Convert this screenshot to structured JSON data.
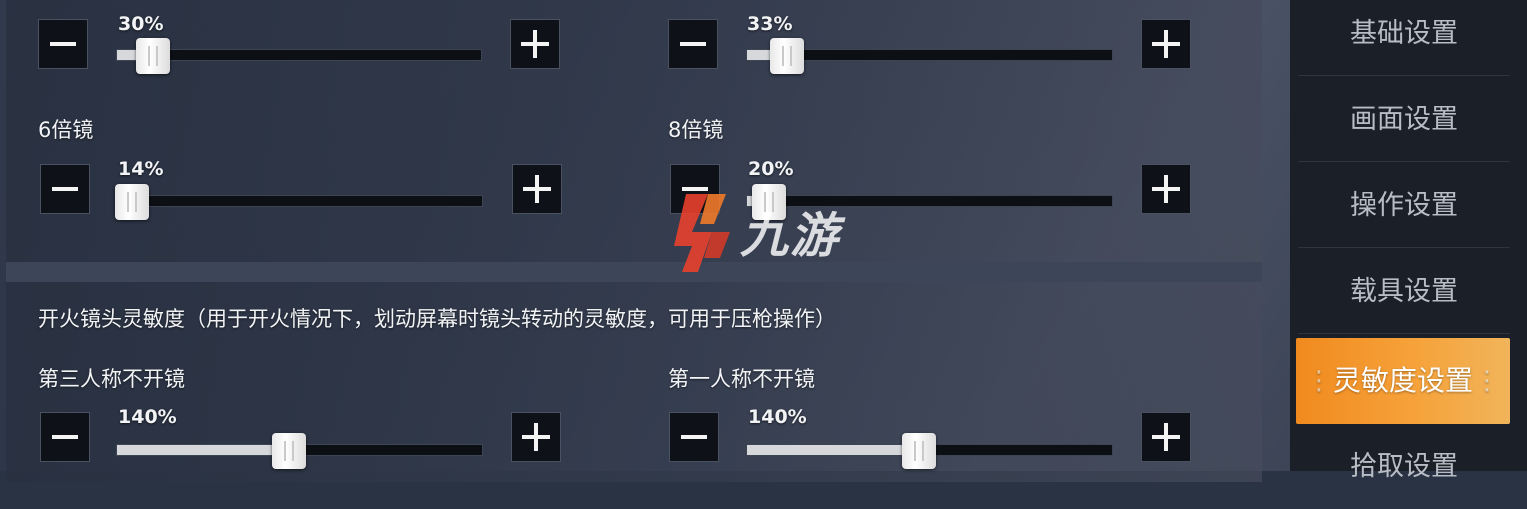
{
  "sliders": {
    "r1_left": {
      "value": "30%"
    },
    "r1_right": {
      "value": "33%"
    },
    "scope6": {
      "label": "6倍镜",
      "value": "14%"
    },
    "scope8": {
      "label": "8倍镜",
      "value": "20%"
    },
    "tpp": {
      "label": "第三人称不开镜",
      "value": "140%"
    },
    "fpp": {
      "label": "第一人称不开镜",
      "value": "140%"
    }
  },
  "fire_section": {
    "title": "开火镜头灵敏度（用于开火情况下，划动屏幕时镜头转动的灵敏度，可用于压枪操作）"
  },
  "sidebar": {
    "items": [
      {
        "label": "基础设置"
      },
      {
        "label": "画面设置"
      },
      {
        "label": "操作设置"
      },
      {
        "label": "载具设置"
      },
      {
        "label": "灵敏度设置",
        "active": true
      },
      {
        "label": "拾取设置"
      }
    ]
  },
  "watermark": {
    "text": "九游"
  },
  "colors": {
    "accent": "#f39a2b",
    "track": "#0c0f14",
    "button": "#0e1117"
  },
  "icons": {
    "minus": "minus-icon",
    "plus": "plus-icon"
  }
}
